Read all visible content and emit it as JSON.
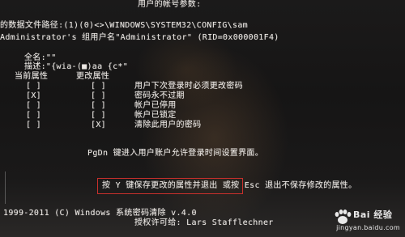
{
  "screen": {
    "top_title": "用户的帐号参数:",
    "lines": {
      "path_line": "的数据文件路径:(1)(0)<>\\WINDOWS\\SYSTEM32\\CONFIG\\sam",
      "group_line": "Administrator's 组用户名\"Administrator\" (RID=0x000001F4)",
      "fullname_line": "全名:\"\"",
      "desc_line": "描述:\"{wia-(■)aa {c*\"",
      "current_header": "当前属性",
      "change_header": "更改属性"
    },
    "attributes": [
      {
        "current": "[ ]",
        "change": "[ ]",
        "label": "用户下次登录时必须更改密码"
      },
      {
        "current": "[X]",
        "change": "[ ]",
        "label": "密码永不过期"
      },
      {
        "current": "[ ]",
        "change": "[ ]",
        "label": "帐户已停用"
      },
      {
        "current": "[ ]",
        "change": "[ ]",
        "label": "帐户已锁定"
      },
      {
        "current": "[ ]",
        "change": "[X]",
        "label": "清除此用户的密码"
      }
    ],
    "pgdn_line": "PgDn 键进入用户账户允许登录时间设置界面。",
    "action_line": "按 Y 键保存更改的属性并退出 或按 Esc 退出不保存修改的属性。",
    "footer": {
      "copyright": "1999-2011 (C)  Windows 系统密码清除 v.4.0",
      "license": "授权许可给:  Lars Stafflechner"
    },
    "watermark": {
      "brand": "Bai 经验",
      "site": "jingyan.baidu.com"
    }
  },
  "colors": {
    "text": "#ece8e4",
    "background": "#151414",
    "highlight_border": "#c9302c"
  }
}
